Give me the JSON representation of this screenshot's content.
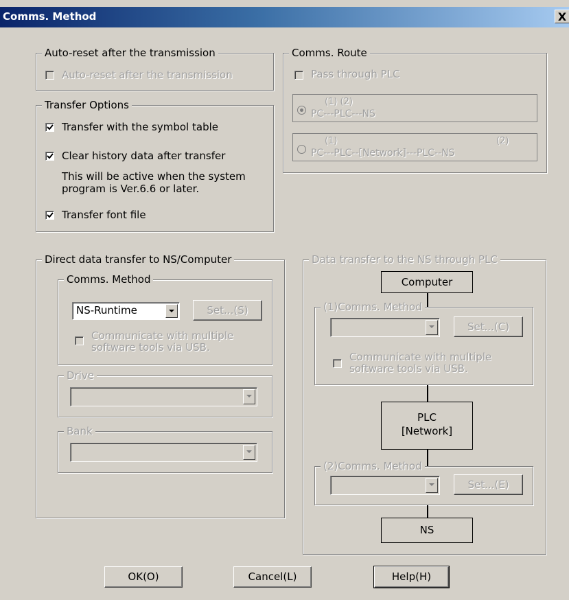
{
  "window": {
    "title": "Comms. Method",
    "close_label": "X"
  },
  "auto_reset": {
    "group_label": "Auto-reset after the transmission",
    "checkbox_label": "Auto-reset after the transmission",
    "checked": false
  },
  "transfer_options": {
    "group_label": "Transfer Options",
    "symbol_table_label": "Transfer with the symbol table",
    "clear_history_label": "Clear history data after transfer",
    "note_line1": "This will be active when the system",
    "note_line2": "program is Ver.6.6 or later.",
    "font_file_label": "Transfer font file"
  },
  "comms_route": {
    "group_label": "Comms. Route",
    "pass_through_label": "Pass through PLC",
    "route1_numbers": "(1)       (2)",
    "route1_text": "PC---PLC---NS",
    "route2_num1": "(1)",
    "route2_num2": "(2)",
    "route2_text": "PC---PLC--[Network]---PLC--NS"
  },
  "direct_transfer": {
    "group_label": "Direct data transfer to NS/Computer",
    "method_group_label": "Comms. Method",
    "method_value": "NS-Runtime",
    "set_button": "Set...(S)",
    "usb_line1": "Communicate with multiple",
    "usb_line2": "software tools via USB.",
    "drive_label": "Drive",
    "bank_label": "Bank"
  },
  "plc_transfer": {
    "group_label": "Data transfer to the NS through PLC",
    "computer_box": "Computer",
    "method1_label": "(1)Comms. Method",
    "set1_button": "Set...(C)",
    "usb_line1": "Communicate with multiple",
    "usb_line2": "software tools via USB.",
    "plc_line1": "PLC",
    "plc_line2": "[Network]",
    "method2_label": "(2)Comms. Method",
    "set2_button": "Set...(E)",
    "ns_box": "NS"
  },
  "buttons": {
    "ok": "OK(O)",
    "cancel": "Cancel(L)",
    "help": "Help(H)"
  }
}
